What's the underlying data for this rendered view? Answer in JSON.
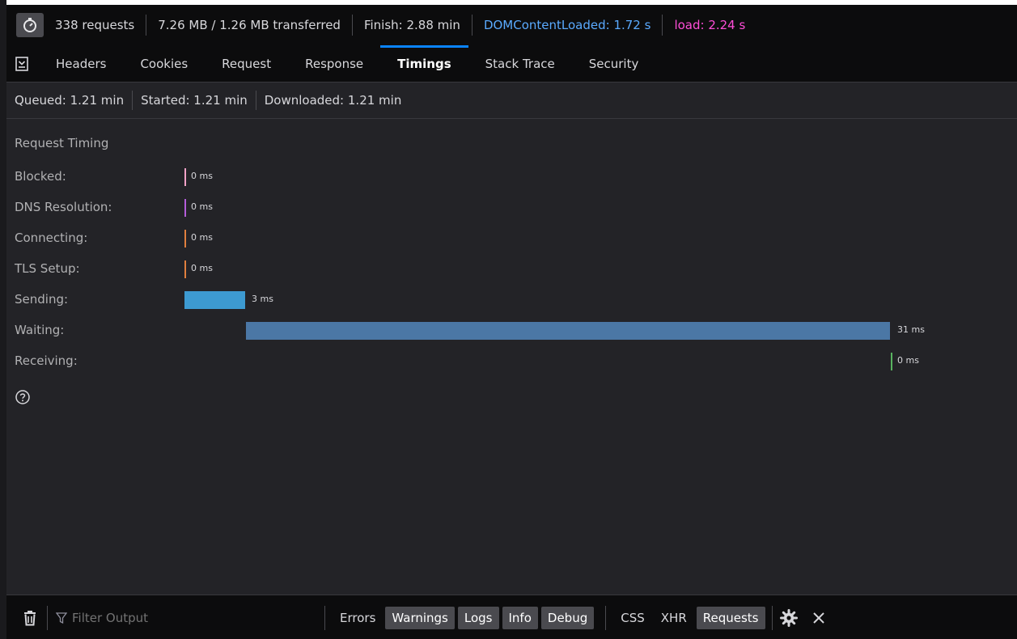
{
  "summary": {
    "requests": "338 requests",
    "transferred": "7.26 MB / 1.26 MB transferred",
    "finish": "Finish: 2.88 min",
    "dom_content_loaded": "DOMContentLoaded: 1.72 s",
    "load": "load: 2.24 s",
    "dom_color": "#5aaaff",
    "load_color": "#ff4dd8"
  },
  "tabs": [
    "Headers",
    "Cookies",
    "Request",
    "Response",
    "Timings",
    "Stack Trace",
    "Security"
  ],
  "selected_tab": "Timings",
  "info": {
    "queued": "Queued: 1.21 min",
    "started": "Started: 1.21 min",
    "downloaded": "Downloaded: 1.21 min"
  },
  "timing": {
    "title": "Request Timing",
    "rows": [
      {
        "label": "Blocked:",
        "duration": "0 ms",
        "color": "#f2a2c7"
      },
      {
        "label": "DNS Resolution:",
        "duration": "0 ms",
        "color": "#b45cd9"
      },
      {
        "label": "Connecting:",
        "duration": "0 ms",
        "color": "#e07f3e"
      },
      {
        "label": "TLS Setup:",
        "duration": "0 ms",
        "color": "#e07f3e"
      },
      {
        "label": "Sending:",
        "duration": "3 ms",
        "color": "#3d9ad1"
      },
      {
        "label": "Waiting:",
        "duration": "31 ms",
        "color": "#4b77a5"
      },
      {
        "label": "Receiving:",
        "duration": "0 ms",
        "color": "#58b35f"
      }
    ]
  },
  "console": {
    "filter_placeholder": "Filter Output",
    "levels": [
      {
        "label": "Errors",
        "active": false
      },
      {
        "label": "Warnings",
        "active": true
      },
      {
        "label": "Logs",
        "active": true
      },
      {
        "label": "Info",
        "active": true
      },
      {
        "label": "Debug",
        "active": true
      }
    ],
    "types": [
      {
        "label": "CSS",
        "active": false
      },
      {
        "label": "XHR",
        "active": false
      },
      {
        "label": "Requests",
        "active": true
      }
    ]
  },
  "icons": {
    "timer": "stopwatch-icon",
    "panel": "toggle-sidebar-icon",
    "help": "question-mark-icon",
    "trash": "trash-icon",
    "filter": "funnel-icon",
    "settings": "gear-icon",
    "close": "close-icon"
  }
}
